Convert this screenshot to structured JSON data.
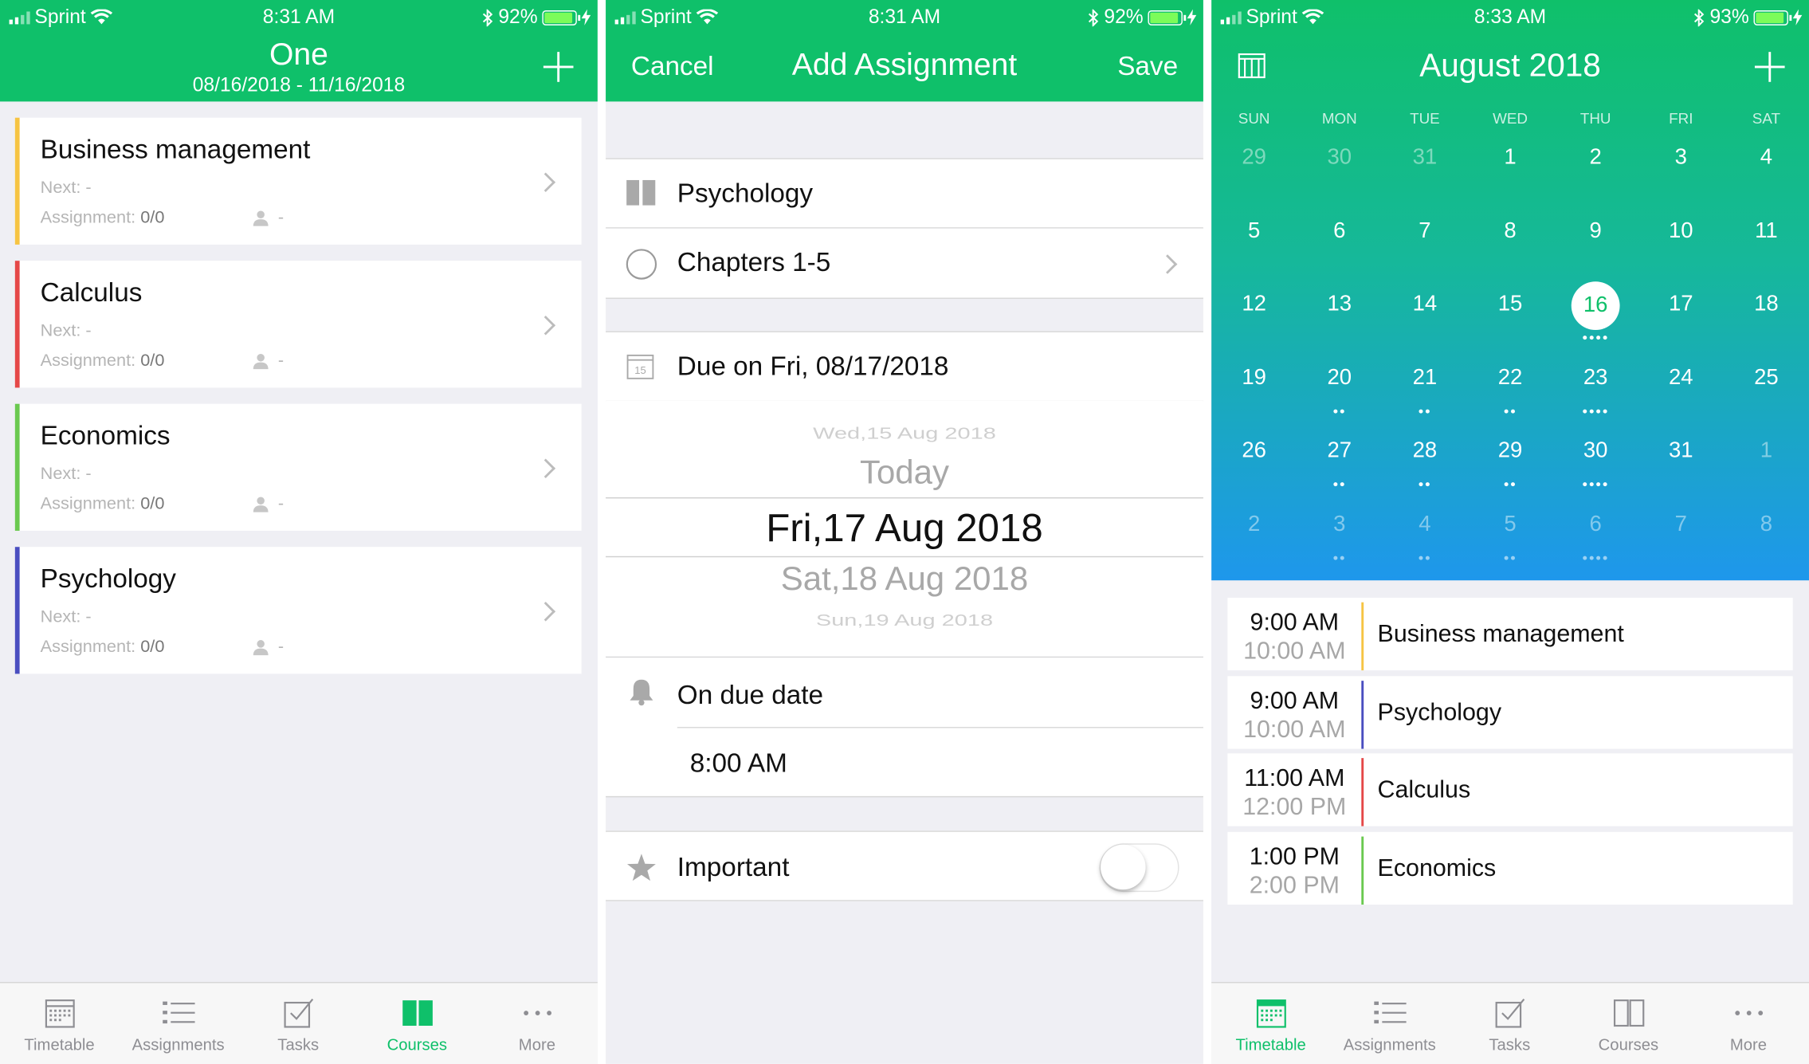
{
  "status_bars": [
    {
      "carrier": "Sprint",
      "time": "8:31 AM",
      "battery": "92%",
      "battery_fraction": 0.92
    },
    {
      "carrier": "Sprint",
      "time": "8:31 AM",
      "battery": "92%",
      "battery_fraction": 0.92
    },
    {
      "carrier": "Sprint",
      "time": "8:33 AM",
      "battery": "93%",
      "battery_fraction": 0.93
    }
  ],
  "colors": {
    "brand_green": "#0fc06a",
    "gradient_blue": "#1e97ec",
    "business": "#f6c443",
    "calculus": "#e54848",
    "economics": "#6ac94f",
    "psychology": "#4a4ec0"
  },
  "courses_screen": {
    "title": "One",
    "subtitle": "08/16/2018 - 11/16/2018",
    "add_icon": "plus-icon",
    "courses": [
      {
        "name": "Business management",
        "next": "Next: -",
        "assign_label": "Assignment: ",
        "assign_value": "0/0",
        "teacher": "-",
        "color": "#f6c443"
      },
      {
        "name": "Calculus",
        "next": "Next: -",
        "assign_label": "Assignment: ",
        "assign_value": "0/0",
        "teacher": "-",
        "color": "#e54848"
      },
      {
        "name": "Economics",
        "next": "Next: -",
        "assign_label": "Assignment: ",
        "assign_value": "0/0",
        "teacher": "-",
        "color": "#6ac94f"
      },
      {
        "name": "Psychology",
        "next": "Next: -",
        "assign_label": "Assignment: ",
        "assign_value": "0/0",
        "teacher": "-",
        "color": "#4a4ec0"
      }
    ]
  },
  "add_assignment": {
    "cancel": "Cancel",
    "title": "Add Assignment",
    "save": "Save",
    "course": "Psychology",
    "assignment_name": "Chapters 1-5",
    "due": "Due on Fri, 08/17/2018",
    "calendar_icon_day": "15",
    "picker": [
      "Wed,15 Aug 2018",
      "Today",
      "Fri,17 Aug 2018",
      "Sat,18 Aug 2018",
      "Sun,19 Aug 2018"
    ],
    "reminder": "On due date",
    "reminder_time": "8:00 AM",
    "important": "Important",
    "important_on": false
  },
  "calendar": {
    "title": "August 2018",
    "weekdays": [
      "SUN",
      "MON",
      "TUE",
      "WED",
      "THU",
      "FRI",
      "SAT"
    ],
    "weeks": [
      [
        {
          "d": "29",
          "dim": true,
          "dots": 0
        },
        {
          "d": "30",
          "dim": true,
          "dots": 0
        },
        {
          "d": "31",
          "dim": true,
          "dots": 0
        },
        {
          "d": "1",
          "dots": 0
        },
        {
          "d": "2",
          "dots": 0
        },
        {
          "d": "3",
          "dots": 0
        },
        {
          "d": "4",
          "dots": 0
        }
      ],
      [
        {
          "d": "5",
          "dots": 0
        },
        {
          "d": "6",
          "dots": 0
        },
        {
          "d": "7",
          "dots": 0
        },
        {
          "d": "8",
          "dots": 0
        },
        {
          "d": "9",
          "dots": 0
        },
        {
          "d": "10",
          "dots": 0
        },
        {
          "d": "11",
          "dots": 0
        }
      ],
      [
        {
          "d": "12",
          "dots": 0
        },
        {
          "d": "13",
          "dots": 0
        },
        {
          "d": "14",
          "dots": 0
        },
        {
          "d": "15",
          "dots": 0
        },
        {
          "d": "16",
          "dots": 4,
          "today": true
        },
        {
          "d": "17",
          "dots": 0
        },
        {
          "d": "18",
          "dots": 0
        }
      ],
      [
        {
          "d": "19",
          "dots": 0
        },
        {
          "d": "20",
          "dots": 2
        },
        {
          "d": "21",
          "dots": 2
        },
        {
          "d": "22",
          "dots": 2
        },
        {
          "d": "23",
          "dots": 4
        },
        {
          "d": "24",
          "dots": 0
        },
        {
          "d": "25",
          "dots": 0
        }
      ],
      [
        {
          "d": "26",
          "dots": 0
        },
        {
          "d": "27",
          "dots": 2
        },
        {
          "d": "28",
          "dots": 2
        },
        {
          "d": "29",
          "dots": 2
        },
        {
          "d": "30",
          "dots": 4
        },
        {
          "d": "31",
          "dots": 0
        },
        {
          "d": "1",
          "dim": true,
          "dots": 0
        }
      ],
      [
        {
          "d": "2",
          "dim": true,
          "dots": 0
        },
        {
          "d": "3",
          "dim": true,
          "dots": 2
        },
        {
          "d": "4",
          "dim": true,
          "dots": 2
        },
        {
          "d": "5",
          "dim": true,
          "dots": 2
        },
        {
          "d": "6",
          "dim": true,
          "dots": 4
        },
        {
          "d": "7",
          "dim": true,
          "dots": 0
        },
        {
          "d": "8",
          "dim": true,
          "dots": 0
        }
      ]
    ],
    "events": [
      {
        "start": "9:00 AM",
        "end": "10:00 AM",
        "name": "Business management",
        "color": "#f6c443"
      },
      {
        "start": "9:00 AM",
        "end": "10:00 AM",
        "name": "Psychology",
        "color": "#4a4ec0"
      },
      {
        "start": "11:00 AM",
        "end": "12:00 PM",
        "name": "Calculus",
        "color": "#e54848"
      },
      {
        "start": "1:00 PM",
        "end": "2:00 PM",
        "name": "Economics",
        "color": "#6ac94f"
      }
    ]
  },
  "tabs": [
    {
      "label": "Timetable",
      "icon": "calendar-grid-icon"
    },
    {
      "label": "Assignments",
      "icon": "list-icon"
    },
    {
      "label": "Tasks",
      "icon": "checkbox-icon"
    },
    {
      "label": "Courses",
      "icon": "book-icon"
    },
    {
      "label": "More",
      "icon": "more-dots-icon"
    }
  ],
  "tabbar_left_active": "Courses",
  "tabbar_right_active": "Timetable"
}
